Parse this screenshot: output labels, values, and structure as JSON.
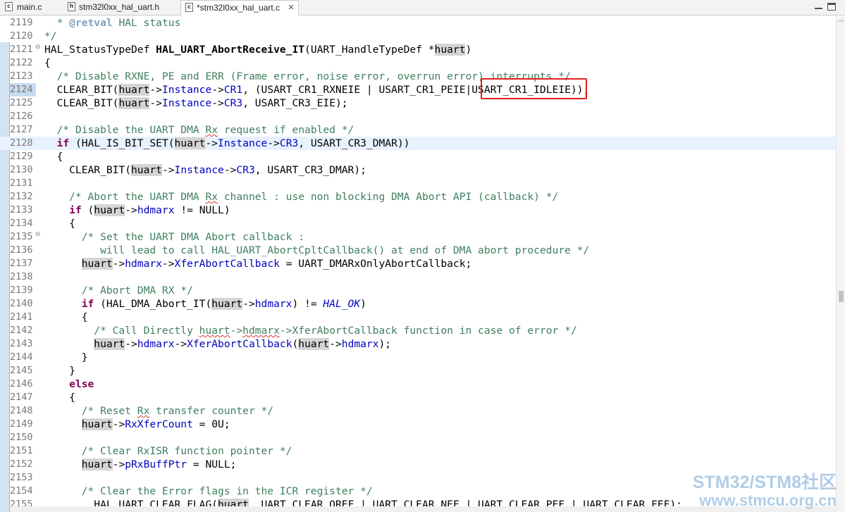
{
  "tabs": [
    {
      "label": "main.c",
      "icon": "c-file-icon",
      "glyph": "c"
    },
    {
      "label": "stm32l0xx_hal_uart.h",
      "icon": "h-file-icon",
      "glyph": "h"
    },
    {
      "label": "*stm32l0xx_hal_uart.c",
      "icon": "c-file-icon",
      "glyph": "c",
      "active": true
    }
  ],
  "watermark": {
    "line1": "STM32/STM8社区",
    "line2": "www.stmcu.org.cn"
  },
  "editor": {
    "current_line": "2128",
    "highlighted_line": "2124",
    "lines": [
      {
        "n": "2119",
        "t": [
          [
            "com",
            "  * "
          ],
          [
            "doc",
            "@retval"
          ],
          [
            "com",
            " HAL status"
          ]
        ]
      },
      {
        "n": "2120",
        "t": [
          [
            "com",
            "*/"
          ]
        ]
      },
      {
        "n": "2121",
        "fold": true,
        "t": [
          [
            "",
            "HAL_StatusTypeDef "
          ],
          [
            "fn",
            "HAL_UART_AbortReceive_IT"
          ],
          [
            "",
            "(UART_HandleTypeDef *"
          ],
          [
            "var",
            "huart"
          ],
          [
            "",
            ")"
          ]
        ]
      },
      {
        "n": "2122",
        "t": [
          [
            "",
            "{"
          ]
        ]
      },
      {
        "n": "2123",
        "t": [
          [
            "com",
            "  /* Disable RXNE, PE and ERR (Frame error, noise error, overrun error) interrupts */"
          ]
        ]
      },
      {
        "n": "2124",
        "t": [
          [
            "",
            "  CLEAR_BIT("
          ],
          [
            "var",
            "huart"
          ],
          [
            "",
            "->"
          ],
          [
            "fld",
            "Instance"
          ],
          [
            "",
            "->"
          ],
          [
            "fld",
            "CR1"
          ],
          [
            "",
            ", (USART_CR1_RXNEIE | USART_CR1_PEIE|USART_CR1_IDLEIE));"
          ]
        ]
      },
      {
        "n": "2125",
        "t": [
          [
            "",
            "  CLEAR_BIT("
          ],
          [
            "var",
            "huart"
          ],
          [
            "",
            "->"
          ],
          [
            "fld",
            "Instance"
          ],
          [
            "",
            "->"
          ],
          [
            "fld",
            "CR3"
          ],
          [
            "",
            ", USART_CR3_EIE);"
          ]
        ]
      },
      {
        "n": "2126",
        "t": []
      },
      {
        "n": "2127",
        "t": [
          [
            "com",
            "  /* Disable the UART DMA "
          ],
          [
            "comsq",
            "Rx"
          ],
          [
            "com",
            " request if enabled */"
          ]
        ]
      },
      {
        "n": "2128",
        "t": [
          [
            "",
            "  "
          ],
          [
            "kw",
            "if"
          ],
          [
            "",
            " (HAL_IS_BIT_SET("
          ],
          [
            "var",
            "huart"
          ],
          [
            "",
            "->"
          ],
          [
            "fld",
            "Instance"
          ],
          [
            "",
            "->"
          ],
          [
            "fld",
            "CR3"
          ],
          [
            "",
            ", USART_CR3_DMAR))"
          ]
        ]
      },
      {
        "n": "2129",
        "t": [
          [
            "",
            "  {"
          ]
        ]
      },
      {
        "n": "2130",
        "t": [
          [
            "",
            "    CLEAR_BIT("
          ],
          [
            "var",
            "huart"
          ],
          [
            "",
            "->"
          ],
          [
            "fld",
            "Instance"
          ],
          [
            "",
            "->"
          ],
          [
            "fld",
            "CR3"
          ],
          [
            "",
            ", USART_CR3_DMAR);"
          ]
        ]
      },
      {
        "n": "2131",
        "t": []
      },
      {
        "n": "2132",
        "t": [
          [
            "com",
            "    /* Abort the UART DMA "
          ],
          [
            "comsq",
            "Rx"
          ],
          [
            "com",
            " channel : use non blocking DMA Abort API (callback) */"
          ]
        ]
      },
      {
        "n": "2133",
        "t": [
          [
            "",
            "    "
          ],
          [
            "kw",
            "if"
          ],
          [
            "",
            " ("
          ],
          [
            "var",
            "huart"
          ],
          [
            "",
            "->"
          ],
          [
            "fld",
            "hdmarx"
          ],
          [
            "",
            " != NULL)"
          ]
        ]
      },
      {
        "n": "2134",
        "t": [
          [
            "",
            "    {"
          ]
        ]
      },
      {
        "n": "2135",
        "fold": true,
        "t": [
          [
            "com",
            "      /* Set the UART DMA Abort callback :"
          ]
        ]
      },
      {
        "n": "2136",
        "t": [
          [
            "com",
            "         will lead to call HAL_UART_AbortCpltCallback() at end of DMA abort procedure */"
          ]
        ]
      },
      {
        "n": "2137",
        "t": [
          [
            "",
            "      "
          ],
          [
            "var",
            "huart"
          ],
          [
            "",
            "->"
          ],
          [
            "fld",
            "hdmarx"
          ],
          [
            "",
            "->"
          ],
          [
            "fld",
            "XferAbortCallback"
          ],
          [
            "",
            " = UART_DMARxOnlyAbortCallback;"
          ]
        ]
      },
      {
        "n": "2138",
        "t": []
      },
      {
        "n": "2139",
        "t": [
          [
            "com",
            "      /* Abort DMA RX */"
          ]
        ]
      },
      {
        "n": "2140",
        "t": [
          [
            "",
            "      "
          ],
          [
            "kw",
            "if"
          ],
          [
            "",
            " (HAL_DMA_Abort_IT("
          ],
          [
            "var",
            "huart"
          ],
          [
            "",
            "->"
          ],
          [
            "fld",
            "hdmarx"
          ],
          [
            "",
            ") != "
          ],
          [
            "cst",
            "HAL_OK"
          ],
          [
            "",
            ")"
          ]
        ]
      },
      {
        "n": "2141",
        "t": [
          [
            "",
            "      {"
          ]
        ]
      },
      {
        "n": "2142",
        "t": [
          [
            "com",
            "        /* Call Directly "
          ],
          [
            "comsq",
            "huart"
          ],
          [
            "com",
            "->"
          ],
          [
            "comsq",
            "hdmarx"
          ],
          [
            "com",
            "->XferAbortCallback function in case of error */"
          ]
        ]
      },
      {
        "n": "2143",
        "t": [
          [
            "",
            "        "
          ],
          [
            "var",
            "huart"
          ],
          [
            "",
            "->"
          ],
          [
            "fld",
            "hdmarx"
          ],
          [
            "",
            "->"
          ],
          [
            "fld",
            "XferAbortCallback"
          ],
          [
            "",
            "("
          ],
          [
            "var",
            "huart"
          ],
          [
            "",
            "->"
          ],
          [
            "fld",
            "hdmarx"
          ],
          [
            "",
            ");"
          ]
        ]
      },
      {
        "n": "2144",
        "t": [
          [
            "",
            "      }"
          ]
        ]
      },
      {
        "n": "2145",
        "t": [
          [
            "",
            "    }"
          ]
        ]
      },
      {
        "n": "2146",
        "t": [
          [
            "",
            "    "
          ],
          [
            "kw",
            "else"
          ]
        ]
      },
      {
        "n": "2147",
        "t": [
          [
            "",
            "    {"
          ]
        ]
      },
      {
        "n": "2148",
        "t": [
          [
            "com",
            "      /* Reset "
          ],
          [
            "comsq",
            "Rx"
          ],
          [
            "com",
            " transfer counter */"
          ]
        ]
      },
      {
        "n": "2149",
        "t": [
          [
            "",
            "      "
          ],
          [
            "var",
            "huart"
          ],
          [
            "",
            "->"
          ],
          [
            "fld",
            "RxXferCount"
          ],
          [
            "",
            " = 0U;"
          ]
        ]
      },
      {
        "n": "2150",
        "t": []
      },
      {
        "n": "2151",
        "t": [
          [
            "com",
            "      /* Clear RxISR function pointer */"
          ]
        ]
      },
      {
        "n": "2152",
        "t": [
          [
            "",
            "      "
          ],
          [
            "var",
            "huart"
          ],
          [
            "",
            "->"
          ],
          [
            "fld",
            "pRxBuffPtr"
          ],
          [
            "",
            " = NULL;"
          ]
        ]
      },
      {
        "n": "2153",
        "t": []
      },
      {
        "n": "2154",
        "t": [
          [
            "com",
            "      /* Clear the Error flags in the ICR register */"
          ]
        ]
      },
      {
        "n": "2155",
        "t": [
          [
            "",
            "        HAL_UART_CLEAR_FLAG("
          ],
          [
            "var",
            "huart"
          ],
          [
            "",
            ", UART_CLEAR_OREF | UART_CLEAR_NEF | UART_CLEAR_PEF | UART_CLEAR_FEF);"
          ]
        ]
      }
    ]
  }
}
